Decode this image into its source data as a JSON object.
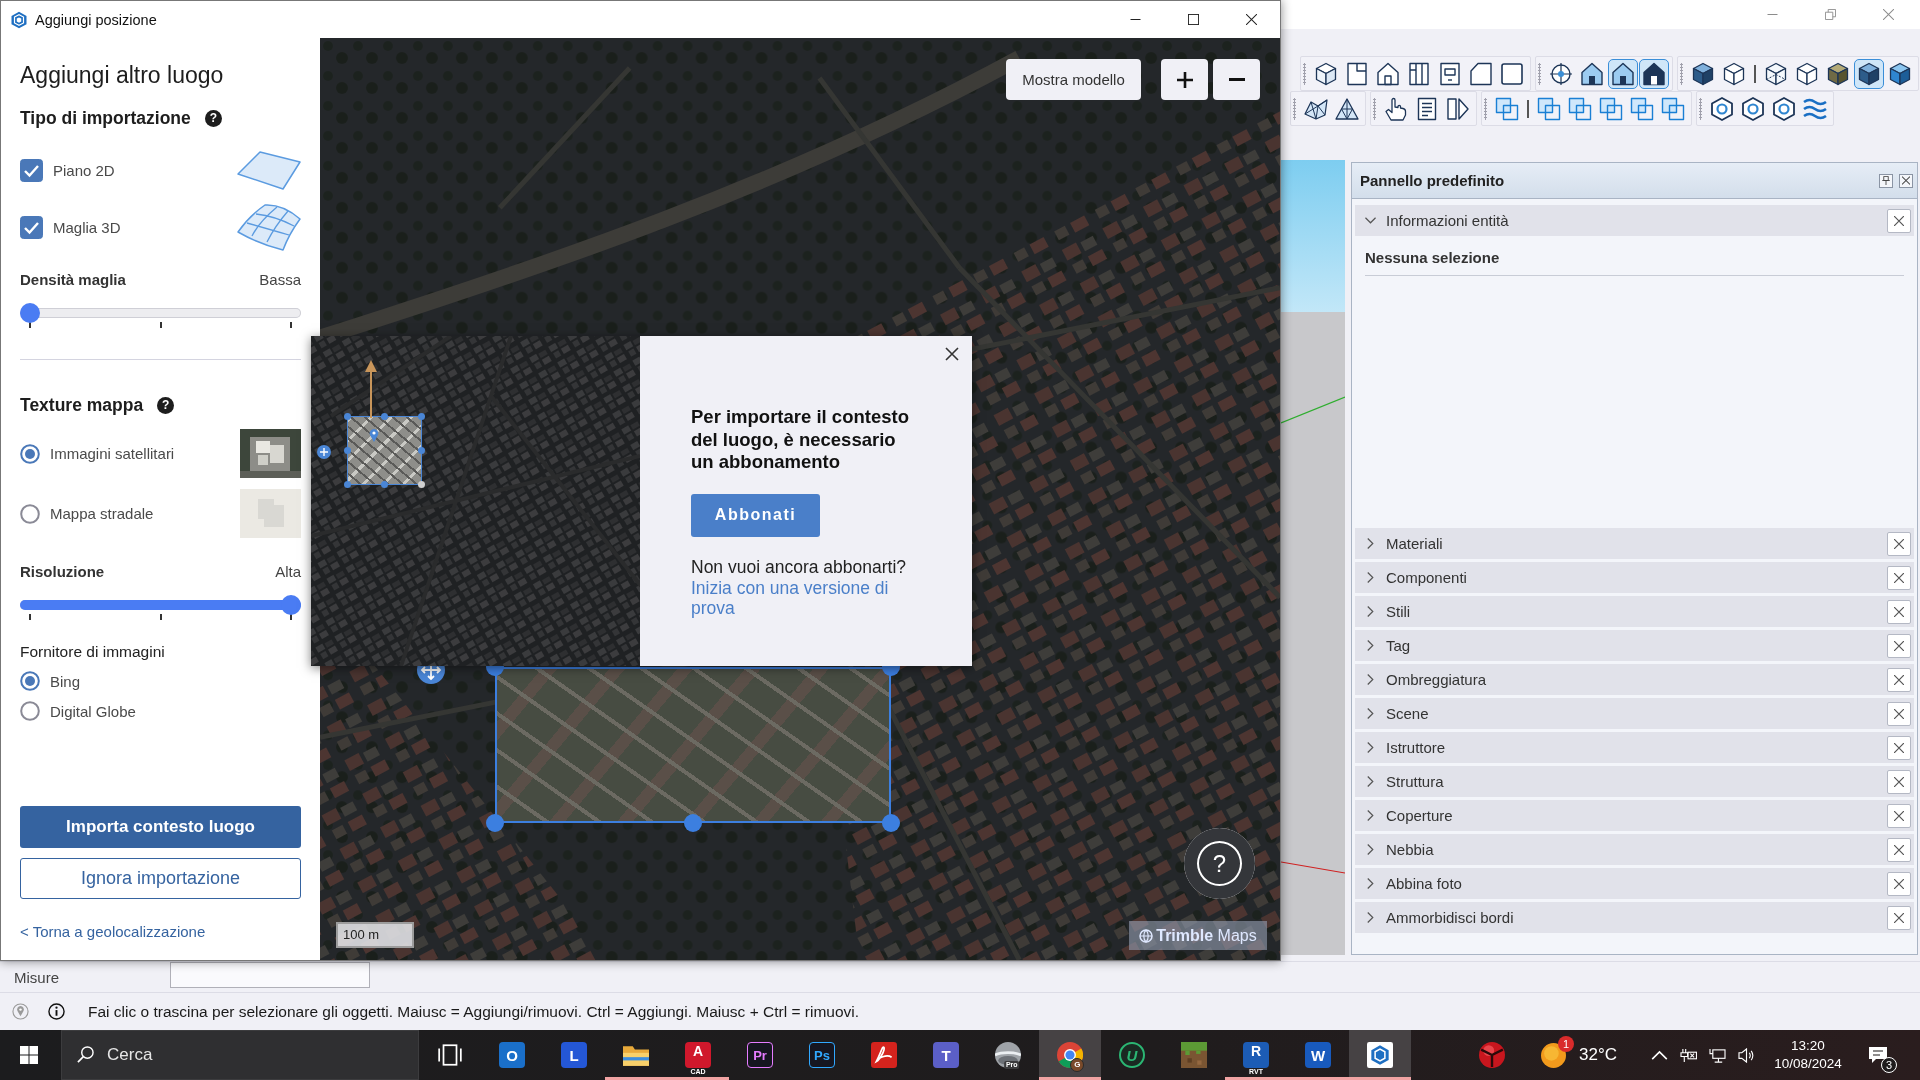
{
  "dialog": {
    "title": "Aggiungi posizione",
    "heading": "Aggiungi altro luogo",
    "import_type": {
      "title": "Tipo di importazione",
      "help": "?",
      "options": [
        {
          "label": "Piano 2D",
          "checked": true,
          "kind": "plane"
        },
        {
          "label": "Maglia 3D",
          "checked": true,
          "kind": "mesh"
        }
      ]
    },
    "mesh_density": {
      "label": "Densità maglia",
      "value": "Bassa",
      "level": 0
    },
    "map_texture": {
      "title": "Texture mappa",
      "help": "?",
      "options": [
        {
          "label": "Immagini satellitari",
          "selected": true,
          "kind": "satellite"
        },
        {
          "label": "Mappa stradale",
          "selected": false,
          "kind": "street"
        }
      ]
    },
    "resolution": {
      "label": "Risoluzione",
      "value": "Alta",
      "level": 1
    },
    "provider": {
      "label": "Fornitore di immagini",
      "options": [
        {
          "label": "Bing",
          "selected": true
        },
        {
          "label": "Digital Globe",
          "selected": false
        }
      ]
    },
    "actions": [
      {
        "label": "Importa contesto luogo",
        "kind": "primary"
      },
      {
        "label": "Ignora importazione",
        "kind": "secondary"
      }
    ],
    "back_link": "< Torna a geolocalizzazione",
    "map": {
      "show_model": "Mostra modello",
      "help": "?",
      "scale": "100 m",
      "attribution": "**Trimble** Maps"
    },
    "popup": {
      "message": "Per importare il contesto del luogo, è necessario un abbonamento",
      "button": "Abbonati",
      "question": "Non vuoi ancora abbonarti?",
      "link": "Inizia con una versione di prova"
    }
  },
  "toolbars": [
    {
      "groups": [
        {
          "items": [
            {
              "kind": "iso",
              "pressed": false
            },
            {
              "kind": "top",
              "pressed": false
            },
            {
              "kind": "front",
              "pressed": false
            },
            {
              "kind": "right",
              "pressed": false
            },
            {
              "kind": "back",
              "pressed": false
            },
            {
              "kind": "left",
              "pressed": false
            },
            {
              "kind": "bottom",
              "pressed": false
            }
          ]
        },
        {
          "items": [
            {
              "kind": "target",
              "pressed": false
            },
            {
              "kind": "house-blue",
              "pressed": false
            },
            {
              "kind": "house-blue",
              "pressed": true
            },
            {
              "kind": "house-dark",
              "pressed": true
            }
          ]
        },
        {
          "items": [
            {
              "kind": "cube-dark",
              "pressed": false
            },
            {
              "kind": "cube-outline",
              "pressed": false
            },
            {
              "kind": "separator"
            },
            {
              "kind": "cube-wire",
              "pressed": false
            },
            {
              "kind": "cube-outline",
              "pressed": false
            },
            {
              "kind": "cube-olive",
              "pressed": false
            },
            {
              "kind": "cube-dark",
              "pressed": true
            },
            {
              "kind": "cube-blue",
              "pressed": false
            }
          ]
        }
      ]
    },
    {
      "groups": [
        {
          "items": [
            {
              "kind": "mesh",
              "pressed": false
            },
            {
              "kind": "mesh-tri",
              "pressed": false
            }
          ]
        },
        {
          "items": [
            {
              "kind": "hand",
              "pressed": false
            },
            {
              "kind": "document",
              "pressed": false
            },
            {
              "kind": "split",
              "pressed": false
            }
          ]
        },
        {
          "items": [
            {
              "kind": "squares",
              "pressed": false
            },
            {
              "kind": "separator"
            },
            {
              "kind": "squares",
              "pressed": false
            },
            {
              "kind": "squares",
              "pressed": false
            },
            {
              "kind": "squares",
              "pressed": false
            },
            {
              "kind": "squares",
              "pressed": false
            },
            {
              "kind": "squares",
              "pressed": false
            }
          ]
        },
        {
          "items": [
            {
              "kind": "hexagon",
              "pressed": false
            },
            {
              "kind": "hexagon",
              "pressed": false
            },
            {
              "kind": "hexagon",
              "pressed": false
            },
            {
              "kind": "waves",
              "pressed": false
            }
          ]
        }
      ]
    }
  ],
  "tray": {
    "title": "Pannello predefinito",
    "panels": [
      {
        "label": "Informazioni entità",
        "expanded": true,
        "body": "Nessuna selezione"
      },
      {
        "label": "Materiali",
        "expanded": false
      },
      {
        "label": "Componenti",
        "expanded": false
      },
      {
        "label": "Stili",
        "expanded": false
      },
      {
        "label": "Tag",
        "expanded": false
      },
      {
        "label": "Ombreggiatura",
        "expanded": false
      },
      {
        "label": "Scene",
        "expanded": false
      },
      {
        "label": "Istruttore",
        "expanded": false
      },
      {
        "label": "Struttura",
        "expanded": false
      },
      {
        "label": "Coperture",
        "expanded": false
      },
      {
        "label": "Nebbia",
        "expanded": false
      },
      {
        "label": "Abbina foto",
        "expanded": false
      },
      {
        "label": "Ammorbidisci bordi",
        "expanded": false
      }
    ]
  },
  "measurements": {
    "label": "Misure"
  },
  "status_bar": {
    "text": "Fai clic o trascina per selezionare gli oggetti. Maiusc = Aggiungi/rimuovi. Ctrl = Aggiungi. Maiusc + Ctrl = rimuovi."
  },
  "taskbar": {
    "search": {
      "placeholder": "Cerca"
    },
    "apps": [
      {
        "kind": "task-view",
        "active": false,
        "running": false
      },
      {
        "kind": "tile",
        "glyph": "O",
        "color": "#1a6fc9",
        "active": false,
        "running": false
      },
      {
        "kind": "tile",
        "glyph": "L",
        "color": "#2457d6",
        "active": false,
        "running": false
      },
      {
        "kind": "folder",
        "active": false,
        "running": true
      },
      {
        "kind": "tile",
        "glyph": "A",
        "caption": "CAD",
        "color": "#d0182c",
        "active": false,
        "running": true
      },
      {
        "kind": "dark-tile",
        "glyph": "Pr",
        "color": "#e57cff",
        "active": false,
        "running": false
      },
      {
        "kind": "dark-tile",
        "glyph": "Ps",
        "color": "#31a8ff",
        "active": false,
        "running": false
      },
      {
        "kind": "pdf",
        "color": "#d4231d",
        "active": false,
        "running": false
      },
      {
        "kind": "tile",
        "glyph": "T",
        "color": "#5b5fc7",
        "active": false,
        "running": false
      },
      {
        "kind": "sphere",
        "caption": "Pro",
        "active": false,
        "running": false
      },
      {
        "kind": "browser",
        "caption": "G",
        "active": true,
        "running": true
      },
      {
        "kind": "ring",
        "glyph": "U",
        "color": "#2bb673",
        "active": false,
        "running": false
      },
      {
        "kind": "block",
        "active": false,
        "running": false
      },
      {
        "kind": "tile",
        "glyph": "R",
        "caption": "RVT",
        "color": "#1c5cb5",
        "active": false,
        "running": true
      },
      {
        "kind": "tile",
        "glyph": "W",
        "color": "#185abd",
        "active": false,
        "running": true
      },
      {
        "kind": "logo",
        "active": true,
        "running": true
      }
    ],
    "system_tray": {
      "weather_badge": "1",
      "temperature": "32°C",
      "time": "13:20",
      "date": "10/08/2024",
      "notification_count": "3"
    }
  }
}
